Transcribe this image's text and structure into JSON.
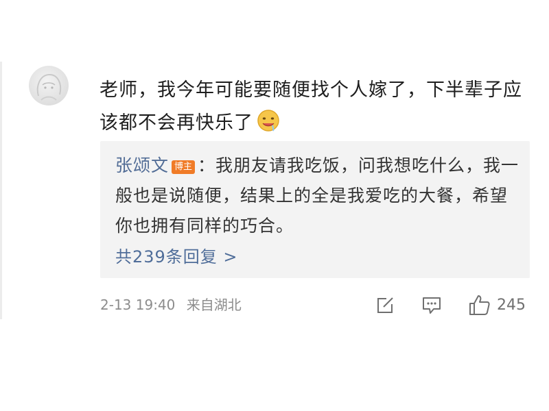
{
  "comment": {
    "text": "老师，我今年可能要随便找个人嫁了，下半辈子应该都不会再快乐了",
    "emoji_icon": "drooling-face-icon",
    "avatar_icon": "avatar-icon"
  },
  "reply": {
    "author": "张颂文",
    "badge": "博主",
    "separator": "：",
    "text": "我朋友请我吃饭，问我想吃什么，我一般也是说随便，结果上的全是我爱吃的大餐，希望你也拥有同样的巧合。",
    "more_label": "共239条回复 >"
  },
  "meta": {
    "timestamp": "2-13 19:40",
    "location": "来自湖北"
  },
  "actions": {
    "share_icon": "share-icon",
    "comment_icon": "comment-icon",
    "like_icon": "thumbs-up-icon",
    "like_count": "245"
  },
  "colors": {
    "link": "#516c96",
    "badge": "#f07b27",
    "reply_bg": "#f3f3f3",
    "meta": "#8c8c8c"
  }
}
